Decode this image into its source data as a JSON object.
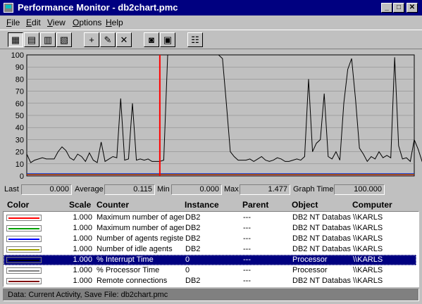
{
  "window": {
    "title": "Performance Monitor - db2chart.pmc",
    "buttons": {
      "minimize": "_",
      "maximize": "□",
      "close": "✕"
    }
  },
  "menu": [
    {
      "label": "File",
      "hot": "F",
      "rest": "ile"
    },
    {
      "label": "Edit",
      "hot": "E",
      "rest": "dit"
    },
    {
      "label": "View",
      "hot": "V",
      "rest": "iew"
    },
    {
      "label": "Options",
      "hot": "O",
      "rest": "ptions"
    },
    {
      "label": "Help",
      "hot": "H",
      "rest": "elp"
    }
  ],
  "toolbar": [
    {
      "name": "chart-view-icon",
      "glyph": "▦",
      "pressed": true
    },
    {
      "name": "alert-view-icon",
      "glyph": "▤",
      "pressed": false
    },
    {
      "name": "log-view-icon",
      "glyph": "▥",
      "pressed": false
    },
    {
      "name": "report-view-icon",
      "glyph": "▧",
      "pressed": false
    },
    {
      "name": "add-counter-icon",
      "glyph": "+",
      "pressed": false
    },
    {
      "name": "edit-counter-icon",
      "glyph": "✎",
      "pressed": false
    },
    {
      "name": "delete-counter-icon",
      "glyph": "✕",
      "pressed": false
    },
    {
      "name": "bookmark-camera-icon",
      "glyph": "◙",
      "pressed": false
    },
    {
      "name": "update-now-icon",
      "glyph": "▣",
      "pressed": false
    },
    {
      "name": "options-icon",
      "glyph": "☷",
      "pressed": false
    }
  ],
  "chart_data": {
    "type": "line",
    "ylim": [
      0,
      100
    ],
    "yticks": [
      "100",
      "90",
      "80",
      "70",
      "60",
      "50",
      "40",
      "30",
      "20",
      "10",
      "0"
    ],
    "grid": true,
    "x_points": 100,
    "current_position": 34,
    "series": [
      {
        "color": "#000000",
        "values": [
          18,
          11,
          13,
          14,
          15,
          14,
          14,
          14,
          20,
          24,
          21,
          15,
          13,
          18,
          16,
          12,
          19,
          13,
          11,
          28,
          12,
          14,
          16,
          15,
          64,
          13,
          14,
          60,
          13,
          14,
          13,
          14,
          12,
          12,
          12,
          13,
          100,
          100,
          100,
          100,
          100,
          100,
          100,
          100,
          100,
          100,
          100,
          100,
          100,
          100,
          97,
          60,
          20,
          16,
          13,
          13,
          13,
          14,
          12,
          14,
          16,
          13,
          12,
          13,
          15,
          14,
          12,
          12,
          13,
          14,
          13,
          16,
          80,
          20,
          27,
          30,
          68,
          16,
          14,
          20,
          13,
          60,
          88,
          97,
          63,
          23,
          18,
          12,
          16,
          14,
          20,
          15,
          17,
          15,
          98,
          25,
          14,
          15,
          12,
          30,
          22,
          12,
          14
        ]
      },
      {
        "color": "#ff0000",
        "values": [
          1,
          1,
          1,
          1,
          1,
          1,
          1,
          1,
          1,
          1,
          1,
          1,
          1,
          1,
          1,
          1,
          1,
          1,
          1,
          1,
          1,
          1,
          1,
          1,
          1,
          1,
          1,
          1,
          1,
          1,
          1,
          1,
          1,
          1,
          1,
          1,
          1,
          1,
          1,
          1,
          1,
          1,
          1,
          1,
          1,
          1,
          1,
          1,
          1,
          1,
          1,
          1,
          1,
          1,
          1,
          1,
          1,
          1,
          1,
          1,
          1,
          1,
          1,
          1,
          1,
          1,
          1,
          1,
          1,
          1,
          1,
          1,
          1,
          1,
          1,
          1,
          1,
          1,
          1,
          1,
          1,
          1,
          1,
          1,
          1,
          1,
          1,
          1,
          1,
          1,
          1,
          1,
          1,
          1,
          1,
          1,
          1,
          1,
          1,
          1
        ]
      },
      {
        "color": "#00a000",
        "values": [
          1.4,
          1.4,
          1.4,
          1.4,
          1.4,
          1.4,
          1.4,
          1.4,
          1.4,
          1.4,
          1.4,
          1.4,
          1.4,
          1.4,
          1.4,
          1.4,
          1.4,
          1.4,
          1.4,
          1.4,
          1.4,
          1.4,
          1.4,
          1.4,
          1.4,
          1.4,
          1.4,
          1.4,
          1.4,
          1.4,
          1.4,
          1.4,
          1.4,
          1.4,
          1.4,
          1.4,
          1.4,
          1.4,
          1.4,
          1.4,
          1.4,
          1.4,
          1.4,
          1.4,
          1.4,
          1.4,
          1.4,
          1.4,
          1.4,
          1.4,
          1.4,
          1.4,
          1.4,
          1.4,
          1.4,
          1.4,
          1.4,
          1.4,
          1.4,
          1.4,
          1.4,
          1.4,
          1.4,
          1.4,
          1.4,
          1.4,
          1.4,
          1.4,
          1.4,
          1.4,
          1.4,
          1.4,
          1.4,
          1.4,
          1.4,
          1.4,
          1.4,
          1.4,
          1.4,
          1.4,
          1.4,
          1.4,
          1.4,
          1.4,
          1.4,
          1.4,
          1.4,
          1.4,
          1.4,
          1.4,
          1.4,
          1.4,
          1.4,
          1.4,
          1.4,
          1.4,
          1.4,
          1.4,
          1.4,
          1.4
        ]
      },
      {
        "color": "#0000ff",
        "values": [
          1.8,
          1.8,
          1.8,
          1.8,
          1.8,
          1.8,
          1.8,
          1.8,
          1.8,
          1.8,
          1.8,
          1.8,
          1.8,
          1.8,
          1.8,
          1.8,
          1.8,
          1.8,
          1.8,
          1.8,
          1.8,
          1.8,
          1.8,
          1.8,
          1.8,
          1.8,
          1.8,
          1.8,
          1.8,
          1.8,
          1.8,
          1.8,
          1.8,
          1.8,
          1.8,
          1.8,
          1.8,
          1.8,
          1.8,
          1.8,
          1.8,
          1.8,
          1.8,
          1.8,
          1.8,
          1.8,
          1.8,
          1.8,
          1.8,
          1.8,
          1.8,
          1.8,
          1.8,
          1.8,
          1.8,
          1.8,
          1.8,
          1.8,
          1.8,
          1.8,
          1.8,
          1.8,
          1.8,
          1.8,
          1.8,
          1.8,
          1.8,
          1.8,
          1.8,
          1.8,
          1.8,
          1.8,
          1.8,
          1.8,
          1.8,
          1.8,
          1.8,
          1.8,
          1.8,
          1.8,
          1.8,
          1.8,
          1.8,
          1.8,
          1.8,
          1.8,
          1.8,
          1.8,
          1.8,
          1.8,
          1.8,
          1.8,
          1.8,
          1.8,
          1.8,
          1.8,
          1.8,
          1.8,
          1.8,
          1.8
        ]
      }
    ]
  },
  "stats": {
    "last_label": "Last",
    "last_value": "0.000",
    "average_label": "Average",
    "average_value": "0.115",
    "min_label": "Min",
    "min_value": "0.000",
    "max_label": "Max",
    "max_value": "1.477",
    "graph_time_label": "Graph Time",
    "graph_time_value": "100.000"
  },
  "legend": {
    "headers": {
      "color": "Color",
      "scale": "Scale",
      "counter": "Counter",
      "instance": "Instance",
      "parent": "Parent",
      "object": "Object",
      "computer": "Computer"
    },
    "rows": [
      {
        "swatch": "#ff0000",
        "scale": "1.000",
        "counter": "Maximum number of agen",
        "instance": "DB2",
        "parent": "---",
        "object": "DB2 NT Databas",
        "computer": "\\\\KARLS"
      },
      {
        "swatch": "#00a000",
        "scale": "1.000",
        "counter": "Maximum number of agen",
        "instance": "DB2",
        "parent": "---",
        "object": "DB2 NT Databas",
        "computer": "\\\\KARLS"
      },
      {
        "swatch": "#0000ff",
        "scale": "1.000",
        "counter": "Number of agents register",
        "instance": "DB2",
        "parent": "---",
        "object": "DB2 NT Databas",
        "computer": "\\\\KARLS"
      },
      {
        "swatch": "#a0a000",
        "scale": "1.000",
        "counter": "Number of idle agents",
        "instance": "DB2",
        "parent": "---",
        "object": "DB2 NT Databas",
        "computer": "\\\\KARLS"
      },
      {
        "swatch": "#000000",
        "scale": "1.000",
        "counter": "% Interrupt Time",
        "instance": "0",
        "parent": "---",
        "object": "Processor",
        "computer": "\\\\KARLS",
        "selected": true
      },
      {
        "swatch": "#808080",
        "scale": "1.000",
        "counter": "% Processor Time",
        "instance": "0",
        "parent": "---",
        "object": "Processor",
        "computer": "\\\\KARLS"
      },
      {
        "swatch": "#800000",
        "scale": "1.000",
        "counter": "Remote connections",
        "instance": "DB2",
        "parent": "---",
        "object": "DB2 NT Databas",
        "computer": "\\\\KARLS"
      }
    ]
  },
  "status": {
    "text": "Data: Current Activity, Save File: db2chart.pmc"
  }
}
